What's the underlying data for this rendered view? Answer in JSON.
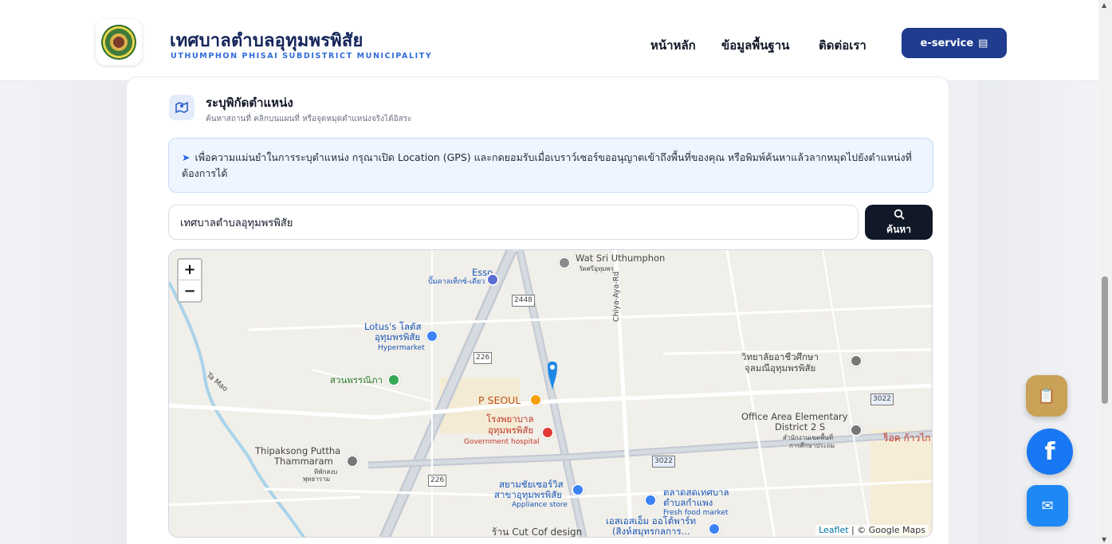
{
  "header": {
    "title": "เทศบาลตำบลอุทุมพรพิสัย",
    "subtitle": "UTHUMPHON PHISAI SUBDISTRICT MUNICIPALITY",
    "nav": [
      "หน้าหลัก",
      "ข้อมูลพื้นฐาน",
      "ติดต่อเรา"
    ],
    "eservice_label": "e-service",
    "eservice_icon": "▤"
  },
  "section": {
    "title": "ระบุพิกัดตำแหน่ง",
    "subtitle": "ค้นหาสถานที่ คลิกบนแผนที่ หรือจุดหมุดตำแหน่งจริงได้อิสระ"
  },
  "notice": {
    "text": "เพื่อความแม่นยำในการระบุตำแหน่ง กรุณาเปิด Location (GPS) และกดยอมรับเมื่อเบราว์เซอร์ขออนุญาตเข้าถึงพื้นที่ของคุณ หรือพิมพ์ค้นหาแล้วลากหมุดไปยังตำแหน่งที่ต้องการได้"
  },
  "search": {
    "value": "เทศบาลตำบลอุทุมพรพิสัย",
    "button_label": "ค้นหา"
  },
  "map": {
    "zoom_in": "+",
    "zoom_out": "−",
    "attribution_leaflet": "Leaflet",
    "attribution_rest": " | © Google Maps",
    "labels": {
      "wat": "Wat Sri Uthumphon",
      "wat_th": "วัดศรีอุทุมพร",
      "esso": "Esso",
      "esso_th": "ปั๊มคาลเท็กซ์-เดียว",
      "route2448": "2448",
      "route226a": "226",
      "route226b": "226",
      "route3022a": "3022",
      "route3022b": "3022",
      "lotus": "Lotus's โลตัส",
      "lotus2": "อุทุมพรพิสัย",
      "lotus3": "Hypermarket",
      "park": "สวนพรรณิภา",
      "road": "Chiya-Aya-Rd",
      "college": "วิทยาลัยอาชีวศึกษา",
      "college2": "จุลมณีอุทุมพรพิสัย",
      "seoul": "P SEOUL",
      "hospital": "โรงพยาบาล",
      "hospital2": "อุทุมพรพิสัย",
      "hospital3": "Government hospital",
      "office": "Office Area Elementary",
      "office2": "District 2 S",
      "office3": "สำนักงานเขตพื้นที่",
      "office4": "การศึกษาประถม",
      "rock": "ร็อค ก้าวไก",
      "thipak": "Thipaksong Puttha",
      "thipak2": "Thammaram",
      "thipak3": "ทิพักสงบ",
      "thipak4": "พุทธาราม",
      "siam": "สยามชัยเซอร์วิส",
      "siam2": "สาขาอุทุมพรพิสัย",
      "siam3": "Appliance store",
      "market": "ตลาดสดเทศบาล",
      "market2": "ตำบลกำแพง",
      "market3": "Fresh food market",
      "sm": "เอสเอสเอ็ม ออโต้พาร์ท",
      "sm2": "(สิงห์สมุทรกลการ...",
      "cut": "ร้าน Cut Cof design",
      "tamao": "Ta Mao"
    }
  },
  "floating": {
    "clipboard_icon": "📋",
    "facebook_icon": "f",
    "messenger_icon": "✉"
  },
  "colors": {
    "brand_navy": "#14245a",
    "eservice_bg": "#1f3c8f",
    "facebook": "#1877f2",
    "messenger": "#1e88f5",
    "gold": "#c9a157"
  }
}
